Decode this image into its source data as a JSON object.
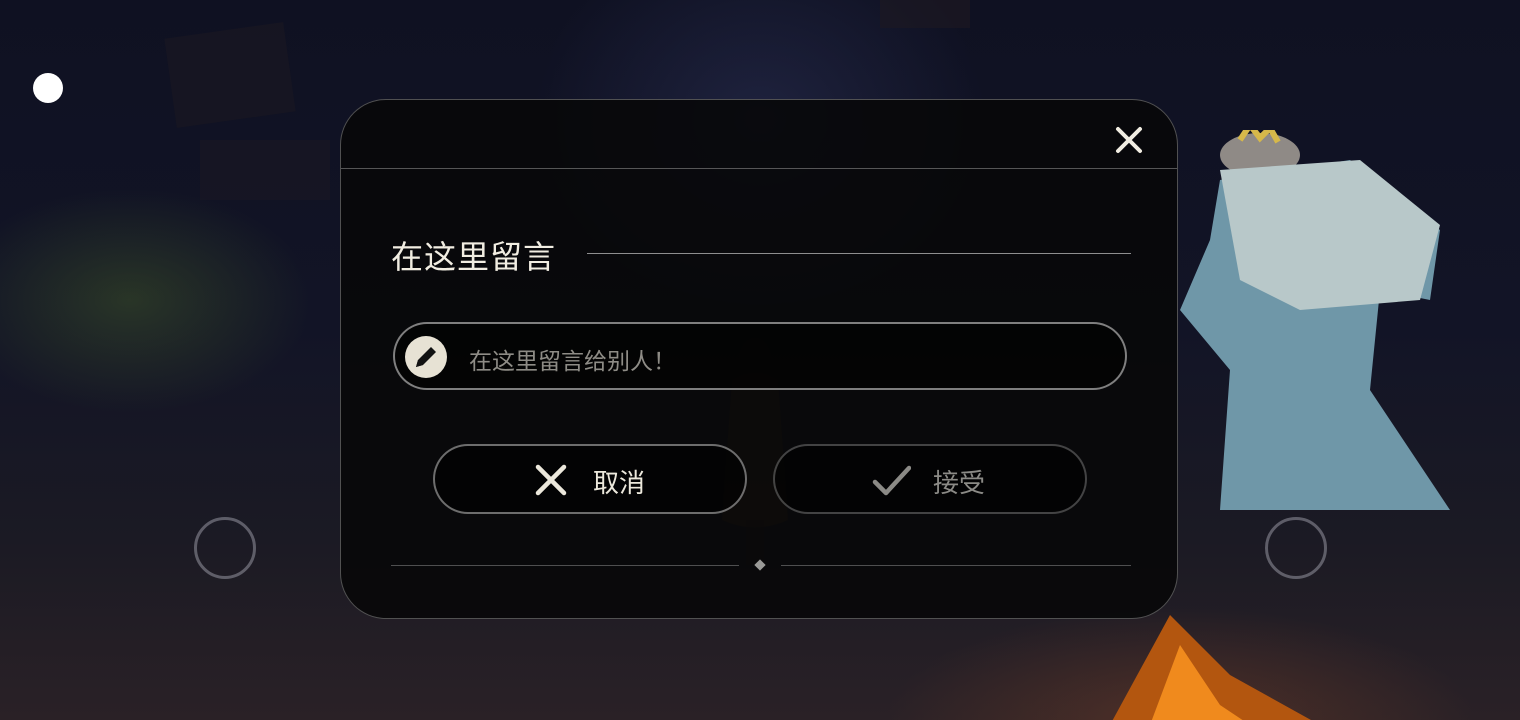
{
  "dialog": {
    "title": "在这里留言",
    "input": {
      "placeholder": "在这里留言给别人！",
      "value": ""
    },
    "buttons": {
      "cancel_label": "取消",
      "accept_label": "接受"
    },
    "icons": {
      "close": "close-icon",
      "pencil": "pencil-icon",
      "cancel": "x-icon",
      "accept": "checkmark-icon"
    }
  },
  "hud": {
    "icons": [
      "status-dot",
      "left-joystick",
      "right-joystick"
    ]
  },
  "colors": {
    "dialog_bg": "#080809",
    "text_primary": "#f1ede2",
    "text_muted": "#8e8c86",
    "pencil_badge": "#e7e2d4"
  }
}
